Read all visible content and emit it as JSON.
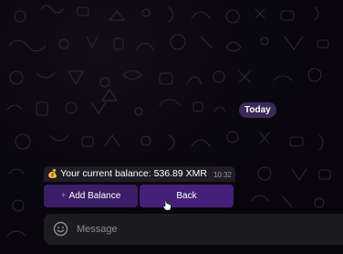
{
  "chat": {
    "date_divider": "Today",
    "message": {
      "emoji_icon": "money-bag-icon",
      "text": "Your current balance: 536.89 XMR",
      "time": "10:32"
    },
    "keyboard": {
      "add_balance_label": "Add Balance",
      "back_label": "Back"
    }
  },
  "composer": {
    "placeholder": "Message",
    "emoji_icon": "smiley-icon"
  },
  "colors": {
    "background": "#08060c",
    "accent": "#3b1d66",
    "date_badge": "#3a2a5a",
    "compose_bar": "#1c1b1f"
  }
}
